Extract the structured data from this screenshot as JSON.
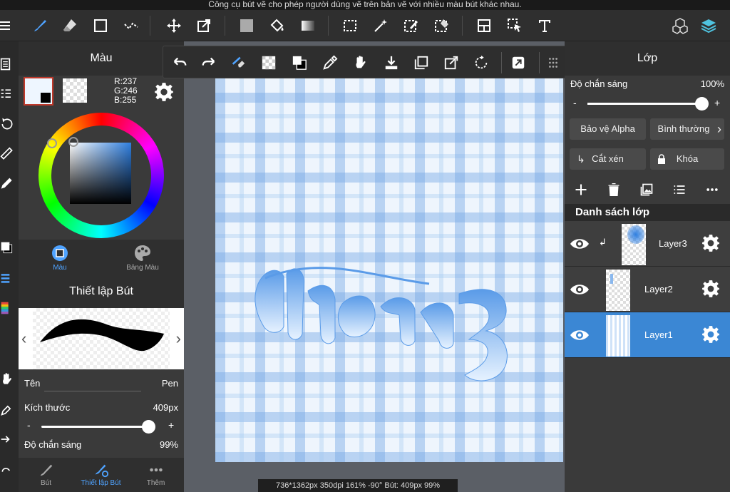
{
  "hint": "Công cụ bút vẽ cho phép người dùng vẽ trên bản vẽ với nhiều màu bút khác nhau.",
  "color_panel": {
    "title": "Màu",
    "r": "R:237",
    "g": "G:246",
    "b": "B:255",
    "tab_color": "Màu",
    "tab_palette": "Bảng Màu"
  },
  "brush_panel": {
    "title": "Thiết lập Bút",
    "name_label": "Tên",
    "name_value": "Pen",
    "size_label": "Kích thước",
    "size_value": "409px",
    "opacity_label": "Độ chắn sáng",
    "opacity_value": "99%",
    "size_fraction": 0.98,
    "minus": "-",
    "plus": "+"
  },
  "bottom_tabs": [
    {
      "label": "Bút"
    },
    {
      "label": "Thiết lập Bút"
    },
    {
      "label": "Thêm"
    }
  ],
  "status": "736*1362px 350dpi 161% -90° Bút: 409px 99%",
  "layer_panel": {
    "title": "Lớp",
    "opacity_label": "Độ chắn sáng",
    "opacity_value": "100%",
    "opacity_fraction": 1.0,
    "alpha_protect": "Bảo vệ Alpha",
    "blend_mode": "Bình thường",
    "clip": "Cắt xén",
    "lock": "Khóa",
    "list_header": "Danh sách lớp",
    "minus": "-",
    "plus": "+",
    "layers": [
      {
        "name": "Layer3",
        "selected": false
      },
      {
        "name": "Layer2",
        "selected": false
      },
      {
        "name": "Layer1",
        "selected": true
      }
    ]
  },
  "colors": {
    "accent": "#3b87d4",
    "active_tab": "#4fa3ff",
    "selected_swatch_border": "#c0392b",
    "current_color": "#edf6ff"
  }
}
